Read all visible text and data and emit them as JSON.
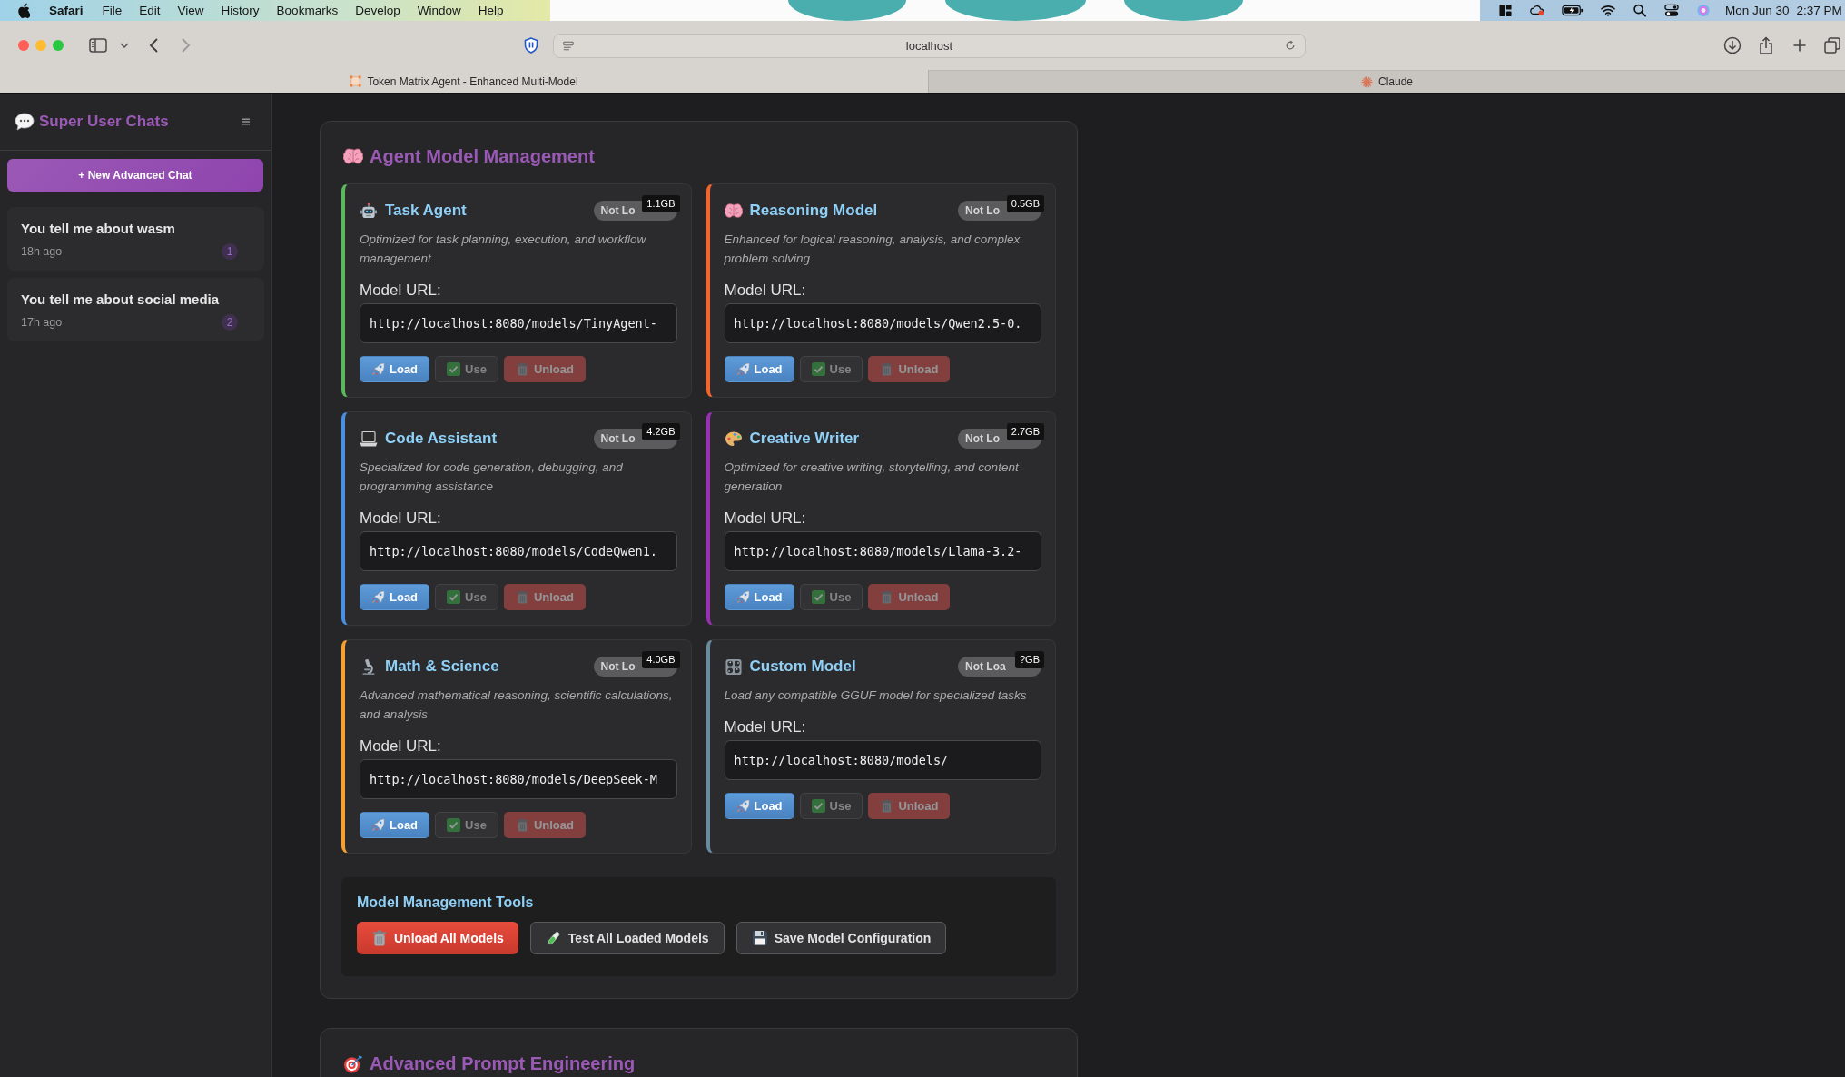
{
  "menu_bar": {
    "app": "Safari",
    "menus": [
      "File",
      "Edit",
      "View",
      "History",
      "Bookmarks",
      "Develop",
      "Window",
      "Help"
    ],
    "date": "Mon Jun 30",
    "time": "2:37 PM"
  },
  "browser": {
    "address": "localhost",
    "tabs": [
      {
        "title": "Token Matrix Agent - Enhanced Multi-Model",
        "selected": true
      },
      {
        "title": "Claude",
        "selected": false
      }
    ]
  },
  "sidebar": {
    "title": "Super User Chats",
    "new_chat": "+ New Advanced Chat",
    "chats": [
      {
        "title": "You tell me about wasm",
        "time": "18h ago",
        "count": "1"
      },
      {
        "title": "You tell me about social media",
        "time": "17h ago",
        "count": "2"
      }
    ]
  },
  "model_section": {
    "title": "Agent Model Management",
    "cards": [
      {
        "name": "Task Agent",
        "color": "#5cb85c",
        "status": "Not Lo",
        "size": "1.1GB",
        "description": "Optimized for task planning, execution, and workflow management",
        "url_label": "Model URL:",
        "url": "http://localhost:8080/models/TinyAgent-",
        "buttons": [
          {
            "label": "Load",
            "kind": "load",
            "disabled": false
          },
          {
            "label": "Use",
            "kind": "use",
            "disabled": true
          },
          {
            "label": "Unload",
            "kind": "unload",
            "disabled": true
          }
        ]
      },
      {
        "name": "Reasoning Model",
        "color": "#f2652f",
        "status": "Not Lo",
        "size": "0.5GB",
        "description": "Enhanced for logical reasoning, analysis, and complex problem solving",
        "url_label": "Model URL:",
        "url": "http://localhost:8080/models/Qwen2.5-0.",
        "buttons": [
          {
            "label": "Load",
            "kind": "load",
            "disabled": false
          },
          {
            "label": "Use",
            "kind": "use",
            "disabled": true
          },
          {
            "label": "Unload",
            "kind": "unload",
            "disabled": true
          }
        ]
      },
      {
        "name": "Code Assistant",
        "color": "#4a90e2",
        "status": "Not Lo",
        "size": "4.2GB",
        "description": "Specialized for code generation, debugging, and programming assistance",
        "url_label": "Model URL:",
        "url": "http://localhost:8080/models/CodeQwen1.",
        "buttons": [
          {
            "label": "Load",
            "kind": "load",
            "disabled": false
          },
          {
            "label": "Use",
            "kind": "use",
            "disabled": true
          },
          {
            "label": "Unload",
            "kind": "unload",
            "disabled": true
          }
        ]
      },
      {
        "name": "Creative Writer",
        "color": "#9b30b5",
        "status": "Not Lo",
        "size": "2.7GB",
        "description": "Optimized for creative writing, storytelling, and content generation",
        "url_label": "Model URL:",
        "url": "http://localhost:8080/models/Llama-3.2-",
        "buttons": [
          {
            "label": "Load",
            "kind": "load",
            "disabled": false
          },
          {
            "label": "Use",
            "kind": "use",
            "disabled": true
          },
          {
            "label": "Unload",
            "kind": "unload",
            "disabled": true
          }
        ]
      },
      {
        "name": "Math & Science",
        "color": "#f5a031",
        "status": "Not Lo",
        "size": "4.0GB",
        "description": "Advanced mathematical reasoning, scientific calculations, and analysis",
        "url_label": "Model URL:",
        "url": "http://localhost:8080/models/DeepSeek-M",
        "buttons": [
          {
            "label": "Load",
            "kind": "load",
            "disabled": false
          },
          {
            "label": "Use",
            "kind": "use",
            "disabled": true
          },
          {
            "label": "Unload",
            "kind": "unload",
            "disabled": true
          }
        ]
      },
      {
        "name": "Custom Model",
        "color": "#6a8aa0",
        "status": "Not Loa",
        "size": "?GB",
        "description": "Load any compatible GGUF model for specialized tasks",
        "url_label": "Model URL:",
        "url": "http://localhost:8080/models/",
        "buttons": [
          {
            "label": "Load",
            "kind": "load",
            "disabled": false
          },
          {
            "label": "Use",
            "kind": "use",
            "disabled": true
          },
          {
            "label": "Unload",
            "kind": "unload",
            "disabled": true
          }
        ]
      }
    ],
    "tools": {
      "title": "Model Management Tools",
      "buttons": [
        {
          "label": "Unload All Models",
          "kind": "danger"
        },
        {
          "label": "Test All Loaded Models",
          "kind": "test"
        },
        {
          "label": "Save Model Configuration",
          "kind": "save"
        }
      ]
    }
  },
  "next_section": {
    "title": "Advanced Prompt Engineering"
  }
}
